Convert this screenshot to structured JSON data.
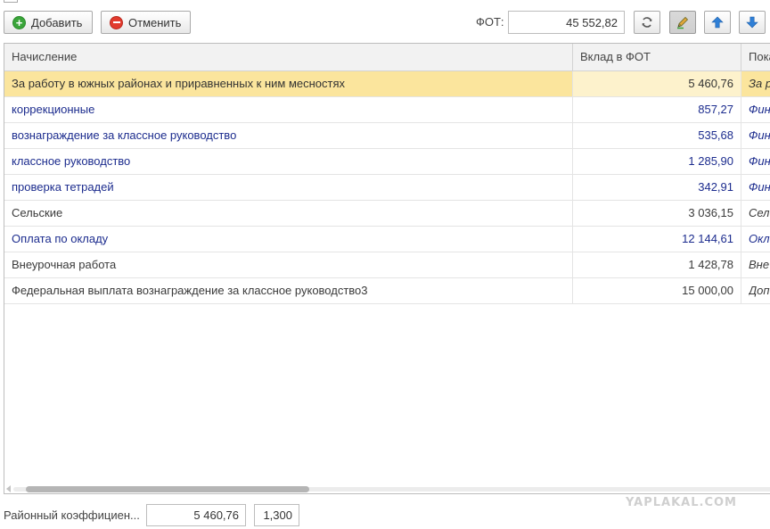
{
  "toolbar": {
    "add_label": "Добавить",
    "cancel_label": "Отменить",
    "fot_label": "ФОТ:",
    "fot_value": "45 552,82"
  },
  "table": {
    "columns": [
      "Начисление",
      "Вклад в ФОТ",
      "Пока"
    ],
    "rows": [
      {
        "name": "За работу в южных районах и приравненных к ним месностях",
        "value": "5 460,76",
        "extra": "За р"
      },
      {
        "name": "коррекционные",
        "value": "857,27",
        "extra": "Фин"
      },
      {
        "name": "вознаграждение за классное руководство",
        "value": "535,68",
        "extra": "Фин"
      },
      {
        "name": "классное руководство",
        "value": "1 285,90",
        "extra": "Фин"
      },
      {
        "name": "проверка тетрадей",
        "value": "342,91",
        "extra": "Фин"
      },
      {
        "name": "Сельские",
        "value": "3 036,15",
        "extra": "Сел"
      },
      {
        "name": "Оплата по окладу",
        "value": "12 144,61",
        "extra": "Окл"
      },
      {
        "name": "Внеурочная работа",
        "value": "1 428,78",
        "extra": "Вне"
      },
      {
        "name": "Федеральная выплата вознаграждение за классное руководство3",
        "value": "15 000,00",
        "extra": "Доп"
      }
    ],
    "selected_row": 0
  },
  "bottom": {
    "label": "Районный коэффициен...",
    "value": "5 460,76",
    "coef": "1,300"
  },
  "watermark": "YAPLAKAL.COM",
  "colors": {
    "selected_row": "#fbe59d",
    "blue_text": "#1c2c8e",
    "add_icon": "#3aa53a",
    "cancel_icon": "#e23b2e",
    "arrow_icon": "#2f7fd6"
  }
}
